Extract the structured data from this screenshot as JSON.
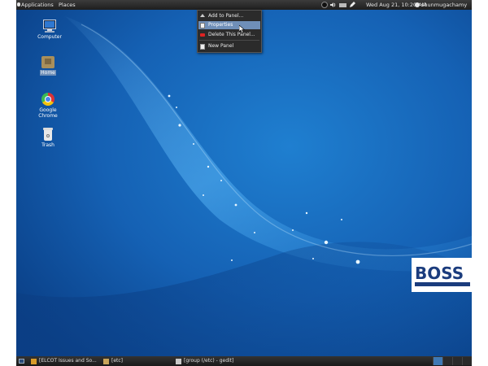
{
  "top_panel": {
    "applications": "Applications",
    "places": "Places",
    "clock": "Wed Aug 21, 10:20 AM",
    "user": "shunmugachamy"
  },
  "context_menu": {
    "items": [
      {
        "label": "Add to Panel..."
      },
      {
        "label": "Properties"
      },
      {
        "label": "Delete This Panel..."
      },
      {
        "label": "New Panel"
      }
    ]
  },
  "desktop_icons": [
    {
      "label": "Computer"
    },
    {
      "label": "Home"
    },
    {
      "label": "Google Chrome"
    },
    {
      "label": "Trash"
    }
  ],
  "taskbar": {
    "tasks": [
      {
        "label": "[ELCOT Issues and So..."
      },
      {
        "label": "[etc]"
      },
      {
        "label": "[group (/etc) - gedit]"
      }
    ]
  },
  "logo_text": "BOSS",
  "colors": {
    "desktop_blue": "#0e4e9c",
    "panel_dark": "#2b2b2b",
    "menu_highlight": "#6f8fb8"
  }
}
